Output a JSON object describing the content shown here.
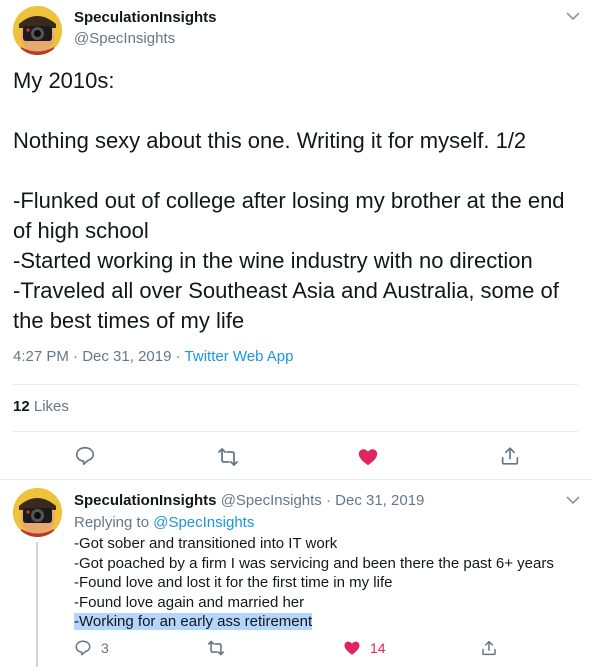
{
  "main_tweet": {
    "display_name": "SpeculationInsights",
    "handle": "@SpecInsights",
    "lines": [
      "My 2010s:",
      "",
      "Nothing sexy about this one. Writing it for myself. 1/2",
      "",
      "-Flunked out of college after losing my brother at the end of high school",
      "-Started working in the wine industry with no direction",
      "-Traveled all over Southeast Asia and Australia, some of the best times of my life"
    ],
    "time": "4:27 PM",
    "date": "Dec 31, 2019",
    "app": "Twitter Web App",
    "likes_count": "12",
    "likes_label": "Likes"
  },
  "reply_tweet": {
    "display_name": "SpeculationInsights",
    "handle": "@SpecInsights",
    "date": "Dec 31, 2019",
    "replying_label": "Replying to",
    "replying_to": "@SpecInsights",
    "lines": [
      "-Got sober and transitioned into IT work",
      "-Got poached by a firm I was servicing and been there the past 6+ years",
      "-Found love and lost it for the first time in my life",
      "-Found love again and married her",
      "-Working for an early ass retirement"
    ],
    "reply_count": "3",
    "like_count": "14"
  },
  "separator": "·",
  "icons": {
    "caret": "chevron-down-icon",
    "reply": "reply-icon",
    "retweet": "retweet-icon",
    "like": "heart-icon",
    "share": "share-icon"
  },
  "colors": {
    "link": "#1b95e0",
    "secondary_text": "#657786",
    "like_red": "#e0245e",
    "selection_highlight": "#b4d5fe"
  }
}
